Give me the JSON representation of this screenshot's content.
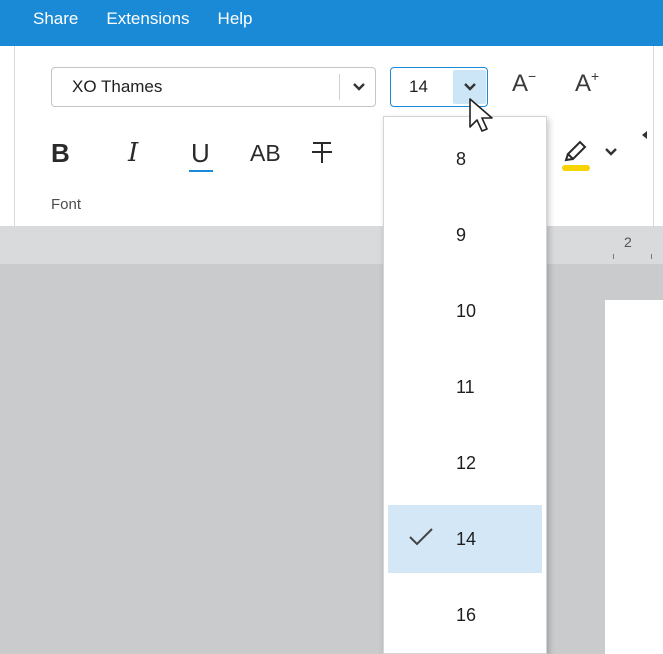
{
  "menu": [
    "Share",
    "Extensions",
    "Help"
  ],
  "font": {
    "name": "XO Thames",
    "size": "14",
    "group_label": "Font",
    "shrink_label": "A",
    "shrink_sup": "−",
    "grow_label": "A",
    "grow_sup": "+",
    "bold_label": "B",
    "italic_label": "I",
    "underline_label": "U",
    "caps_label": "AB",
    "strike_label": "T"
  },
  "ruler": {
    "number": "2"
  },
  "size_options": [
    {
      "label": "8",
      "selected": false
    },
    {
      "label": "9",
      "selected": false
    },
    {
      "label": "10",
      "selected": false
    },
    {
      "label": "11",
      "selected": false
    },
    {
      "label": "12",
      "selected": false
    },
    {
      "label": "14",
      "selected": true
    },
    {
      "label": "16",
      "selected": false
    }
  ],
  "colors": {
    "menubar": "#1a8ad6",
    "highlight": "#f5d400",
    "selected_item": "#d3e7f7",
    "canvas": "#c9cbcc"
  },
  "icons": [
    "chevron-down-icon",
    "highlighter-icon",
    "checkmark-icon",
    "mouse-cursor-icon"
  ]
}
